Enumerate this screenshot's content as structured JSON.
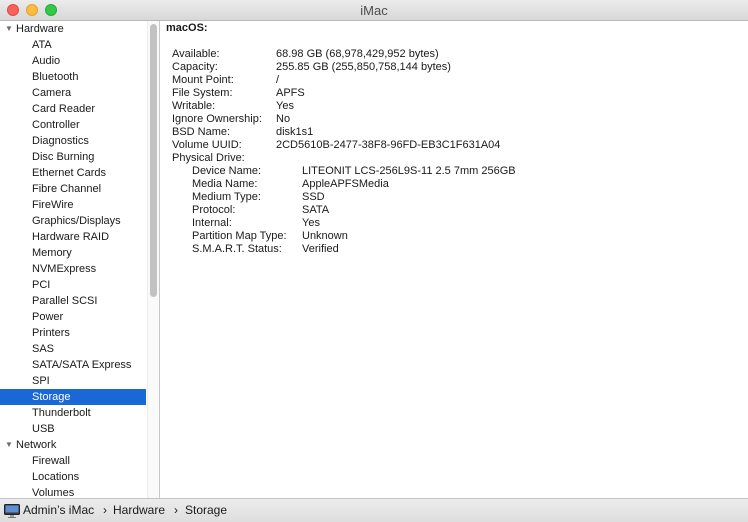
{
  "window": {
    "title": "iMac"
  },
  "sidebar": {
    "groups": [
      {
        "label": "Hardware",
        "items": [
          "ATA",
          "Audio",
          "Bluetooth",
          "Camera",
          "Card Reader",
          "Controller",
          "Diagnostics",
          "Disc Burning",
          "Ethernet Cards",
          "Fibre Channel",
          "FireWire",
          "Graphics/Displays",
          "Hardware RAID",
          "Memory",
          "NVMExpress",
          "PCI",
          "Parallel SCSI",
          "Power",
          "Printers",
          "SAS",
          "SATA/SATA Express",
          "SPI",
          "Storage",
          "Thunderbolt",
          "USB"
        ]
      },
      {
        "label": "Network",
        "items": [
          "Firewall",
          "Locations",
          "Volumes"
        ]
      }
    ],
    "selected": "Storage"
  },
  "detail": {
    "title": "macOS:",
    "fields": [
      {
        "key": "Available:",
        "value": "68.98 GB (68,978,429,952 bytes)"
      },
      {
        "key": "Capacity:",
        "value": "255.85 GB (255,850,758,144 bytes)"
      },
      {
        "key": "Mount Point:",
        "value": "/"
      },
      {
        "key": "File System:",
        "value": "APFS"
      },
      {
        "key": "Writable:",
        "value": "Yes"
      },
      {
        "key": "Ignore Ownership:",
        "value": "No"
      },
      {
        "key": "BSD Name:",
        "value": "disk1s1"
      },
      {
        "key": "Volume UUID:",
        "value": "2CD5610B-2477-38F8-96FD-EB3C1F631A04"
      },
      {
        "key": "Physical Drive:",
        "value": ""
      }
    ],
    "physical_drive": [
      {
        "key": "Device Name:",
        "value": "LITEONIT LCS-256L9S-11 2.5 7mm 256GB"
      },
      {
        "key": "Media Name:",
        "value": "AppleAPFSMedia"
      },
      {
        "key": "Medium Type:",
        "value": "SSD"
      },
      {
        "key": "Protocol:",
        "value": "SATA"
      },
      {
        "key": "Internal:",
        "value": "Yes"
      },
      {
        "key": "Partition Map Type:",
        "value": "Unknown"
      },
      {
        "key": "S.M.A.R.T. Status:",
        "value": "Verified"
      }
    ]
  },
  "statusbar": {
    "path": [
      "Admin’s iMac",
      "Hardware",
      "Storage"
    ],
    "separator": "›"
  },
  "colors": {
    "selection": "#1a68d6",
    "close": "#fc605c",
    "minimize": "#fdbc40",
    "maximize": "#34c84a"
  },
  "icons": {
    "close": "close-icon",
    "minimize": "minimize-icon",
    "maximize": "maximize-icon",
    "disclosure": "disclosure-triangle-icon",
    "computer": "imac-icon"
  }
}
